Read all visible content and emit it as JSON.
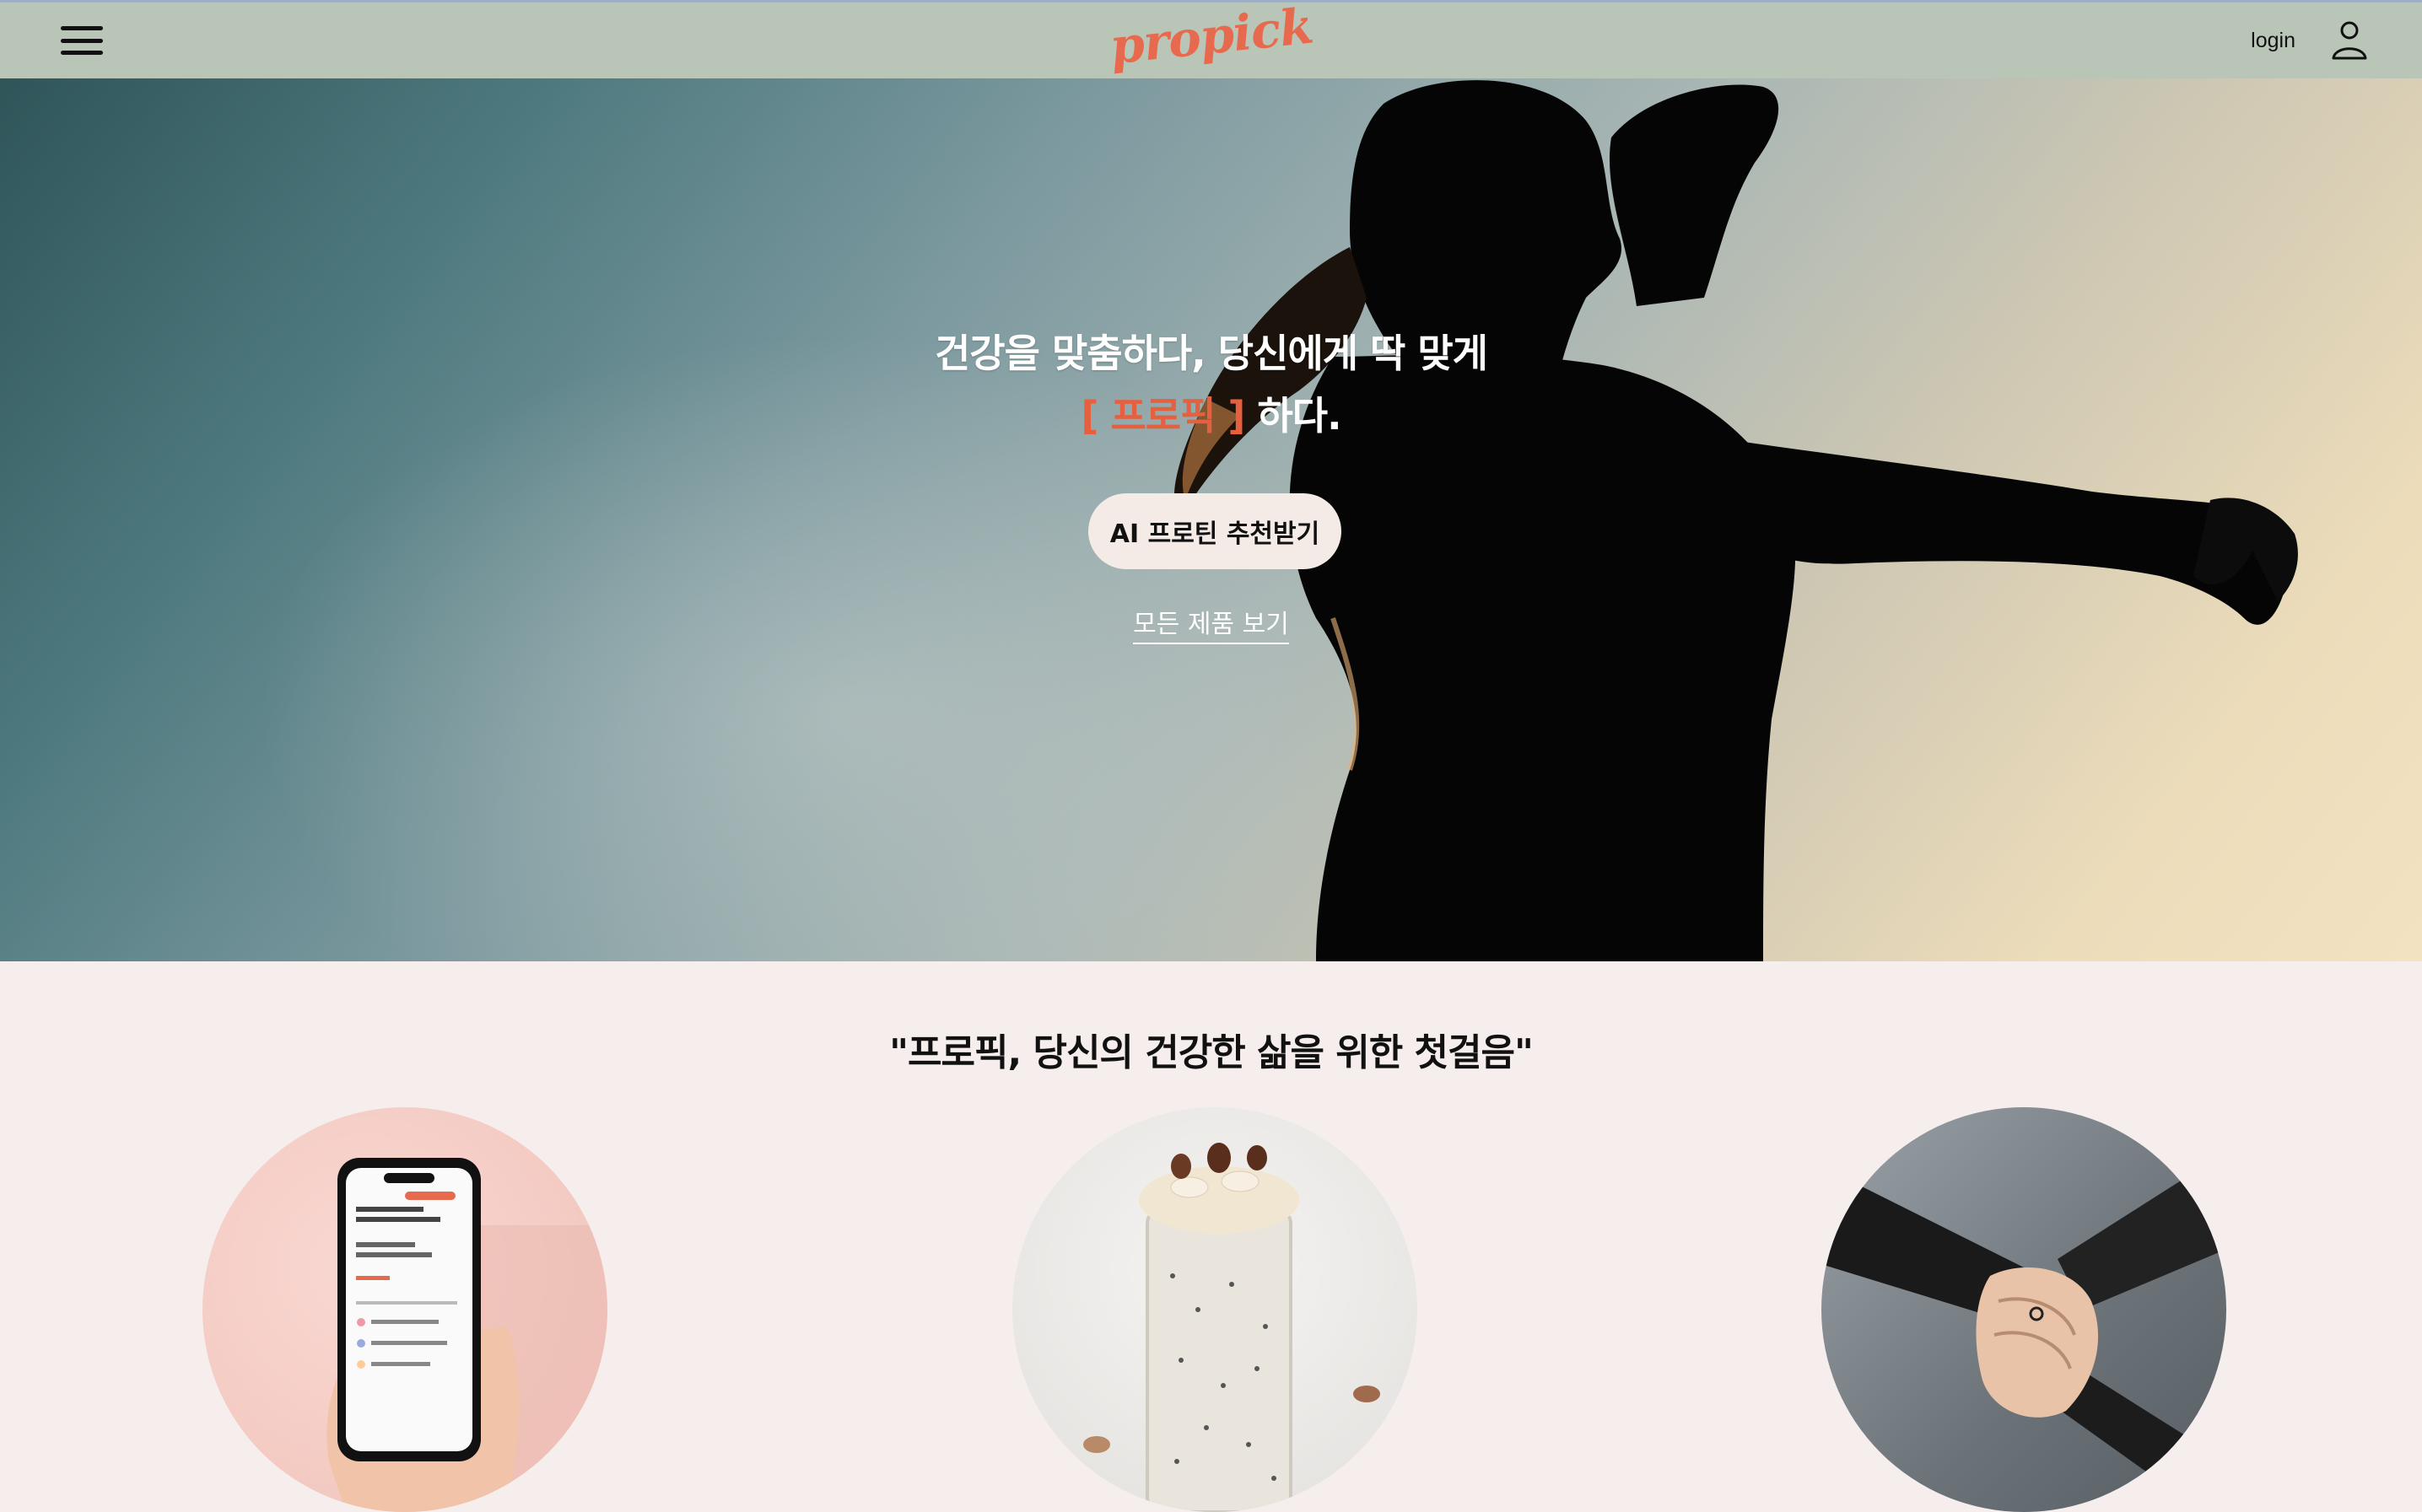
{
  "header": {
    "logo_text": "propick",
    "login_label": "login",
    "menu_icon": "hamburger-menu-icon",
    "user_icon": "user-icon",
    "background": "#b9c6b7"
  },
  "hero": {
    "headline_line1": "건강을 맞춤하다, 당신에게 딱 맞게",
    "headline_bracket_open": "[",
    "headline_brand": "프로픽",
    "headline_bracket_close": "]",
    "headline_suffix": "하다.",
    "cta_label": "AI 프로틴 추천받기",
    "all_products_label": "모든 제품 보기",
    "accent_color": "#e5603f"
  },
  "intro": {
    "title": "\"프로픽, 당신의 건강한 삶을 위한 첫걸음\"",
    "images": [
      "phone-app-image",
      "overnight-oats-image",
      "stacked-hands-image"
    ]
  }
}
